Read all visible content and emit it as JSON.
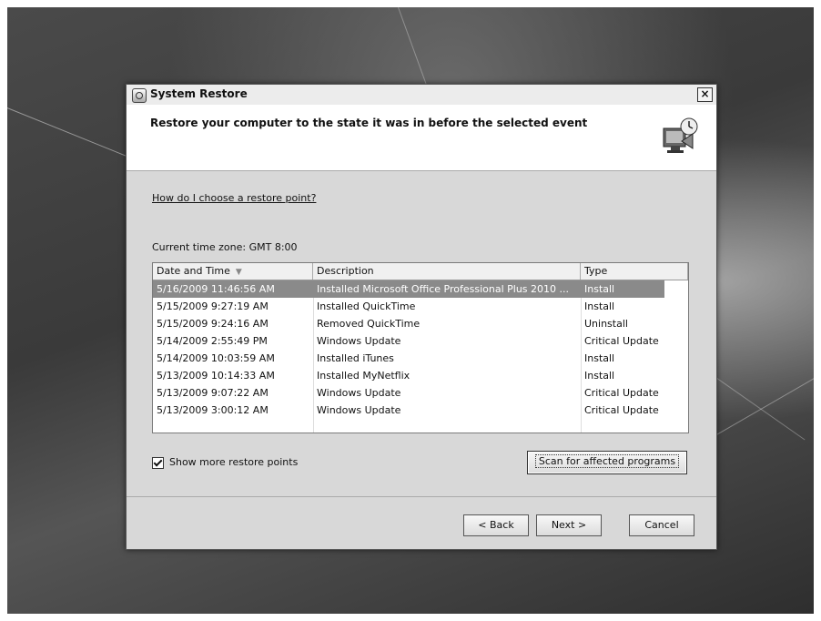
{
  "window": {
    "title": "System Restore",
    "close_label": "×"
  },
  "header": {
    "headline": "Restore your computer to the state it was in before the selected event"
  },
  "help_link": "How do I choose a restore point?",
  "timezone": "Current time zone: GMT 8:00",
  "table": {
    "columns": [
      "Date and Time",
      "Description",
      "Type"
    ],
    "sort_indicator": "▼",
    "rows": [
      {
        "date": "5/16/2009 11:46:56 AM",
        "description": "Installed Microsoft Office Professional Plus 2010 ...",
        "type": "Install",
        "selected": true
      },
      {
        "date": "5/15/2009 9:27:19 AM",
        "description": "Installed QuickTime",
        "type": "Install"
      },
      {
        "date": "5/15/2009 9:24:16 AM",
        "description": "Removed QuickTime",
        "type": "Uninstall"
      },
      {
        "date": "5/14/2009 2:55:49 PM",
        "description": "Windows Update",
        "type": "Critical Update"
      },
      {
        "date": "5/14/2009 10:03:59 AM",
        "description": "Installed iTunes",
        "type": "Install"
      },
      {
        "date": "5/13/2009 10:14:33 AM",
        "description": "Installed MyNetflix",
        "type": "Install"
      },
      {
        "date": "5/13/2009 9:07:22 AM",
        "description": "Windows Update",
        "type": "Critical Update"
      },
      {
        "date": "5/13/2009 3:00:12 AM",
        "description": "Windows Update",
        "type": "Critical Update"
      }
    ]
  },
  "show_more": {
    "label": "Show more restore points",
    "checked": true
  },
  "buttons": {
    "scan": "Scan for affected programs",
    "back": "< Back",
    "next": "Next >",
    "cancel": "Cancel"
  }
}
